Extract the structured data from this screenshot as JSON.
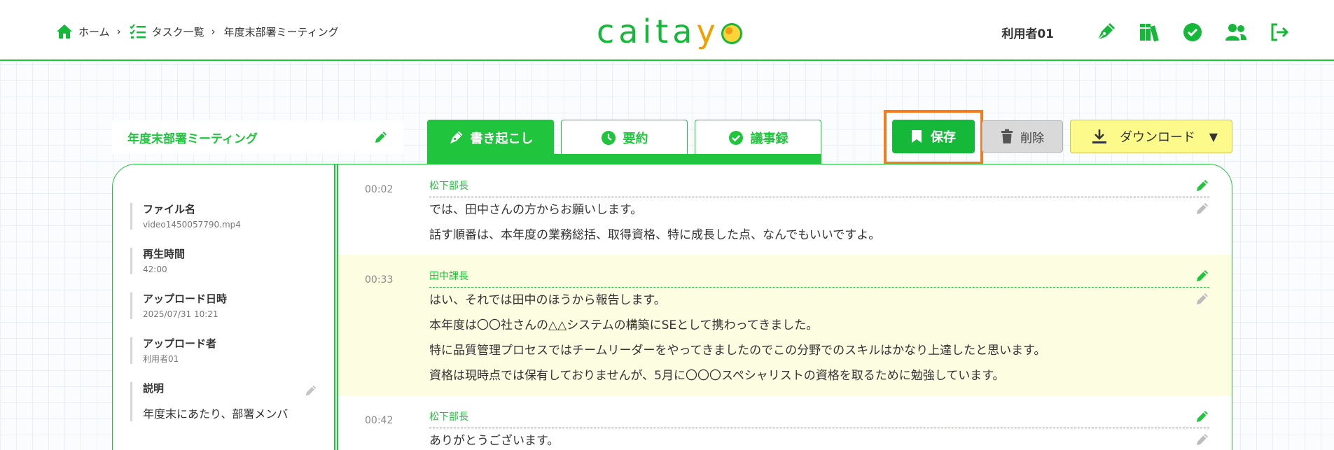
{
  "header": {
    "breadcrumb": [
      {
        "label": "ホーム",
        "icon": "home-icon"
      },
      {
        "label": "タスク一覧",
        "icon": "task-list-icon"
      },
      {
        "label": "年度末部署ミーティング"
      }
    ],
    "logo": "caitayo",
    "user_name": "利用者01",
    "icons": [
      "pen-nib-icon",
      "books-icon",
      "check-circle-icon",
      "users-icon",
      "logout-icon"
    ]
  },
  "task": {
    "title": "年度末部署ミーティング"
  },
  "tabs": [
    {
      "label": "書き起こし",
      "icon": "pen-nib-icon",
      "active": true
    },
    {
      "label": "要約",
      "icon": "clock-icon",
      "active": false
    },
    {
      "label": "議事録",
      "icon": "check-circle-icon",
      "active": false
    }
  ],
  "actions": {
    "save_label": "保存",
    "delete_label": "削除",
    "download_label": "ダウンロード",
    "download_caret": "▼"
  },
  "info": {
    "file_name_label": "ファイル名",
    "file_name": "video1450057790.mp4",
    "duration_label": "再生時間",
    "duration": "42:00",
    "upload_date_label": "アップロード日時",
    "upload_date": "2025/07/31 10:21",
    "uploader_label": "アップロード者",
    "uploader": "利用者01",
    "description_label": "説明",
    "description": "年度末にあたり、部署メンバ"
  },
  "transcript": [
    {
      "time": "00:02",
      "speaker": "松下部長",
      "highlight": false,
      "lines": [
        "では、田中さんの方からお願いします。",
        "話す順番は、本年度の業務総括、取得資格、特に成長した点、なんでもいいですよ。"
      ]
    },
    {
      "time": "00:33",
      "speaker": "田中課長",
      "highlight": true,
      "lines": [
        "はい、それでは田中のほうから報告します。",
        "本年度は〇〇社さんの△△システムの構築にSEとして携わってきました。",
        "特に品質管理プロセスではチームリーダーをやってきましたのでこの分野でのスキルはかなり上達したと思います。",
        "資格は現時点では保有しておりませんが、5月に〇〇〇スペシャリストの資格を取るために勉強しています。"
      ]
    },
    {
      "time": "00:42",
      "speaker": "松下部長",
      "highlight": false,
      "lines": [
        "ありがとうございます。"
      ]
    }
  ],
  "colors": {
    "accent": "#20c53d",
    "save": "#16b83a",
    "highlight_box": "#f47c1f",
    "download_bg": "#fdfa8c",
    "row_highlight": "#fdfde2"
  }
}
